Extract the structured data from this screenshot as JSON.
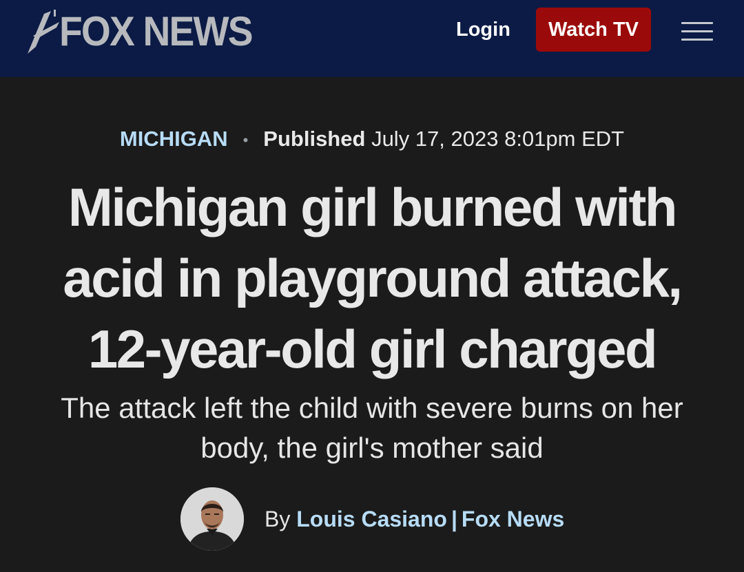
{
  "header": {
    "logo_text": "FOX NEWS",
    "login_label": "Login",
    "watch_tv_label": "Watch TV",
    "menu_icon": "hamburger-menu-icon",
    "colors": {
      "background": "#0b1b45",
      "watch_tv": "#9b0a0a"
    }
  },
  "article": {
    "category": "MICHIGAN",
    "published_label": "Published",
    "published_date": "July 17, 2023 8:01pm EDT",
    "headline": "Michigan girl burned with acid in playground attack, 12-year-old girl charged",
    "subheadline": "The attack left the child with severe burns on her body, the girl's mother said",
    "byline_prefix": "By",
    "author": "Louis Casiano",
    "byline_separator": "|",
    "outlet": "Fox News",
    "colors": {
      "link": "#b7dcf6",
      "background": "#1b1b1b"
    }
  }
}
